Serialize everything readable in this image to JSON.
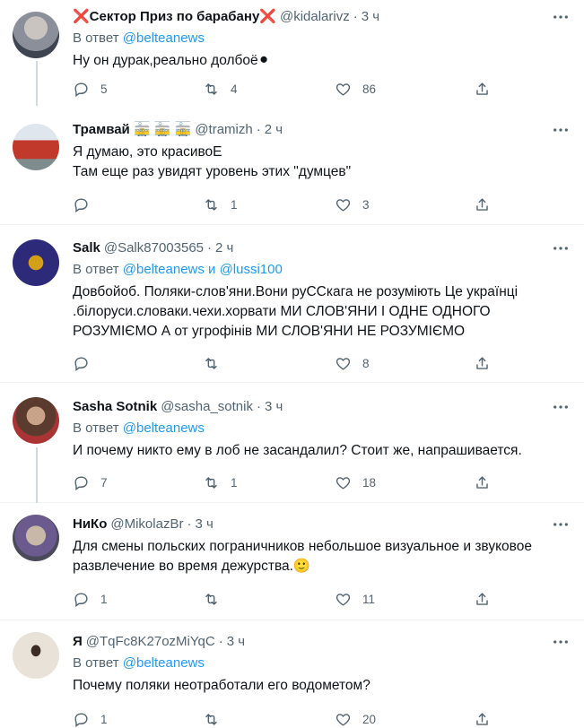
{
  "labels": {
    "reply_prefix": "В ответ"
  },
  "tweets": [
    {
      "name": "❌Сектор Приз по барабану❌",
      "handle": "@kidalarivz",
      "time": "3 ч",
      "reply_to": "@belteanews",
      "text": "Ну он дурак,реально долбоё⚫",
      "replies": "5",
      "retweets": "4",
      "likes": "86",
      "avatar_color": "#8a8f99"
    },
    {
      "name": "Трамвай 🚋 🚋 🚋",
      "handle": "@tramizh",
      "time": "2 ч",
      "reply_to": "",
      "text": "Я думаю, это  красивоЕ\nТам еще раз увидят уровень этих \"думцев\"",
      "replies": "",
      "retweets": "1",
      "likes": "3",
      "avatar_color": "#c0392b"
    },
    {
      "name": "Salk",
      "handle": "@Salk87003565",
      "time": "2 ч",
      "reply_to": "@belteanews и @lussi100",
      "text": "Довбойоб. Поляки-слов'яни.Вони руССкага не розуміють Це українці .білоруси.словаки.чехи.хорвати МИ СЛОВ'ЯНИ І ОДНЕ ОДНОГО РОЗУМІЄМО А от угрофінів МИ СЛОВ'ЯНИ НЕ РОЗУМІЄМО",
      "replies": "",
      "retweets": "",
      "likes": "8",
      "avatar_color": "#2d2a7a"
    },
    {
      "name": "Sasha Sotnik",
      "handle": "@sasha_sotnik",
      "time": "3 ч",
      "reply_to": "@belteanews",
      "text": "И почему никто ему в лоб не засандалил? Стоит же, напрашивается.",
      "replies": "7",
      "retweets": "1",
      "likes": "18",
      "avatar_color": "#5a3b2e"
    },
    {
      "name": "НиКо",
      "handle": "@MikolazBr",
      "time": "3 ч",
      "reply_to": "",
      "text": "Для смены польских пограничников небольшое визуальное и звуковое развлечение во время дежурства.🙂",
      "replies": "1",
      "retweets": "",
      "likes": "11",
      "avatar_color": "#6b5a8e"
    },
    {
      "name": "Я",
      "handle": "@TqFc8K27ozMiYqC",
      "time": "3 ч",
      "reply_to": "@belteanews",
      "text": "Почему поляки неотработали его водометом?",
      "replies": "1",
      "retweets": "",
      "likes": "20",
      "avatar_color": "#d8cfc0"
    }
  ]
}
